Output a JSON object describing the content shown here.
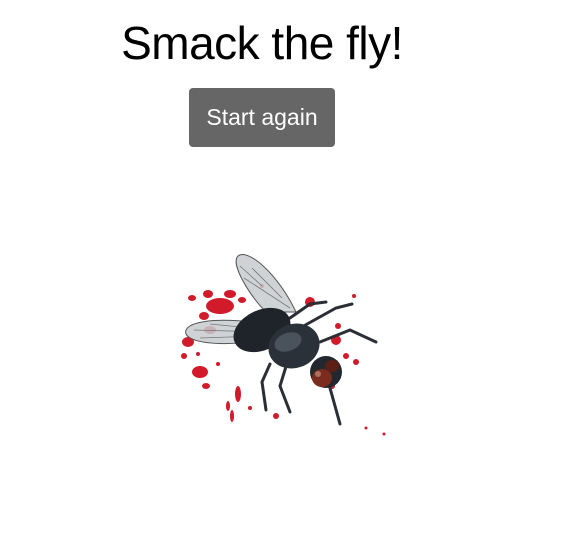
{
  "game": {
    "title": "Smack the fly!",
    "restart_label": "Start again"
  },
  "colors": {
    "button_bg": "#666666",
    "button_text": "#ffffff",
    "blood": "#d11a2a",
    "fly_body": "#1f242b"
  },
  "target": {
    "icon": "squashed-fly-icon",
    "state": "smacked"
  }
}
